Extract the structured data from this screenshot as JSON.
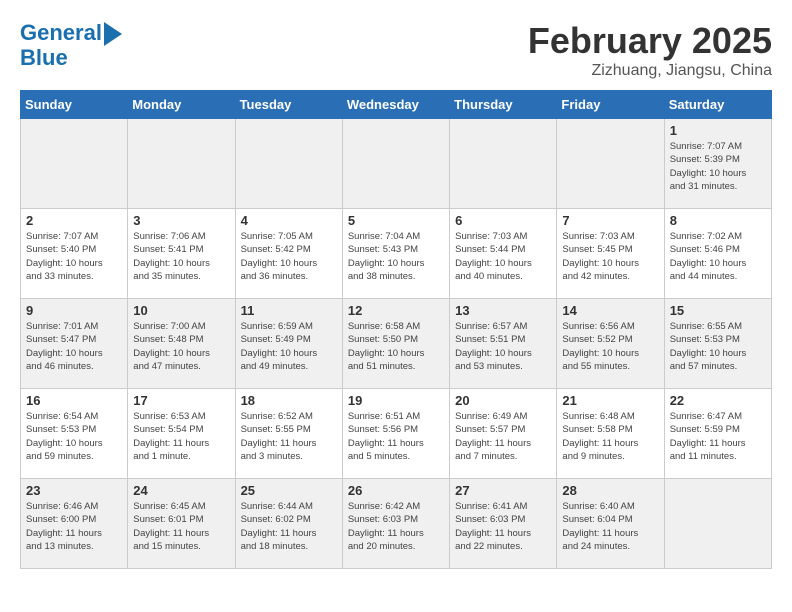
{
  "header": {
    "logo_line1": "General",
    "logo_line2": "Blue",
    "month": "February 2025",
    "location": "Zizhuang, Jiangsu, China"
  },
  "weekdays": [
    "Sunday",
    "Monday",
    "Tuesday",
    "Wednesday",
    "Thursday",
    "Friday",
    "Saturday"
  ],
  "weeks": [
    [
      {
        "day": "",
        "info": ""
      },
      {
        "day": "",
        "info": ""
      },
      {
        "day": "",
        "info": ""
      },
      {
        "day": "",
        "info": ""
      },
      {
        "day": "",
        "info": ""
      },
      {
        "day": "",
        "info": ""
      },
      {
        "day": "1",
        "info": "Sunrise: 7:07 AM\nSunset: 5:39 PM\nDaylight: 10 hours\nand 31 minutes."
      }
    ],
    [
      {
        "day": "2",
        "info": "Sunrise: 7:07 AM\nSunset: 5:40 PM\nDaylight: 10 hours\nand 33 minutes."
      },
      {
        "day": "3",
        "info": "Sunrise: 7:06 AM\nSunset: 5:41 PM\nDaylight: 10 hours\nand 35 minutes."
      },
      {
        "day": "4",
        "info": "Sunrise: 7:05 AM\nSunset: 5:42 PM\nDaylight: 10 hours\nand 36 minutes."
      },
      {
        "day": "5",
        "info": "Sunrise: 7:04 AM\nSunset: 5:43 PM\nDaylight: 10 hours\nand 38 minutes."
      },
      {
        "day": "6",
        "info": "Sunrise: 7:03 AM\nSunset: 5:44 PM\nDaylight: 10 hours\nand 40 minutes."
      },
      {
        "day": "7",
        "info": "Sunrise: 7:03 AM\nSunset: 5:45 PM\nDaylight: 10 hours\nand 42 minutes."
      },
      {
        "day": "8",
        "info": "Sunrise: 7:02 AM\nSunset: 5:46 PM\nDaylight: 10 hours\nand 44 minutes."
      }
    ],
    [
      {
        "day": "9",
        "info": "Sunrise: 7:01 AM\nSunset: 5:47 PM\nDaylight: 10 hours\nand 46 minutes."
      },
      {
        "day": "10",
        "info": "Sunrise: 7:00 AM\nSunset: 5:48 PM\nDaylight: 10 hours\nand 47 minutes."
      },
      {
        "day": "11",
        "info": "Sunrise: 6:59 AM\nSunset: 5:49 PM\nDaylight: 10 hours\nand 49 minutes."
      },
      {
        "day": "12",
        "info": "Sunrise: 6:58 AM\nSunset: 5:50 PM\nDaylight: 10 hours\nand 51 minutes."
      },
      {
        "day": "13",
        "info": "Sunrise: 6:57 AM\nSunset: 5:51 PM\nDaylight: 10 hours\nand 53 minutes."
      },
      {
        "day": "14",
        "info": "Sunrise: 6:56 AM\nSunset: 5:52 PM\nDaylight: 10 hours\nand 55 minutes."
      },
      {
        "day": "15",
        "info": "Sunrise: 6:55 AM\nSunset: 5:53 PM\nDaylight: 10 hours\nand 57 minutes."
      }
    ],
    [
      {
        "day": "16",
        "info": "Sunrise: 6:54 AM\nSunset: 5:53 PM\nDaylight: 10 hours\nand 59 minutes."
      },
      {
        "day": "17",
        "info": "Sunrise: 6:53 AM\nSunset: 5:54 PM\nDaylight: 11 hours\nand 1 minute."
      },
      {
        "day": "18",
        "info": "Sunrise: 6:52 AM\nSunset: 5:55 PM\nDaylight: 11 hours\nand 3 minutes."
      },
      {
        "day": "19",
        "info": "Sunrise: 6:51 AM\nSunset: 5:56 PM\nDaylight: 11 hours\nand 5 minutes."
      },
      {
        "day": "20",
        "info": "Sunrise: 6:49 AM\nSunset: 5:57 PM\nDaylight: 11 hours\nand 7 minutes."
      },
      {
        "day": "21",
        "info": "Sunrise: 6:48 AM\nSunset: 5:58 PM\nDaylight: 11 hours\nand 9 minutes."
      },
      {
        "day": "22",
        "info": "Sunrise: 6:47 AM\nSunset: 5:59 PM\nDaylight: 11 hours\nand 11 minutes."
      }
    ],
    [
      {
        "day": "23",
        "info": "Sunrise: 6:46 AM\nSunset: 6:00 PM\nDaylight: 11 hours\nand 13 minutes."
      },
      {
        "day": "24",
        "info": "Sunrise: 6:45 AM\nSunset: 6:01 PM\nDaylight: 11 hours\nand 15 minutes."
      },
      {
        "day": "25",
        "info": "Sunrise: 6:44 AM\nSunset: 6:02 PM\nDaylight: 11 hours\nand 18 minutes."
      },
      {
        "day": "26",
        "info": "Sunrise: 6:42 AM\nSunset: 6:03 PM\nDaylight: 11 hours\nand 20 minutes."
      },
      {
        "day": "27",
        "info": "Sunrise: 6:41 AM\nSunset: 6:03 PM\nDaylight: 11 hours\nand 22 minutes."
      },
      {
        "day": "28",
        "info": "Sunrise: 6:40 AM\nSunset: 6:04 PM\nDaylight: 11 hours\nand 24 minutes."
      },
      {
        "day": "",
        "info": ""
      }
    ]
  ]
}
